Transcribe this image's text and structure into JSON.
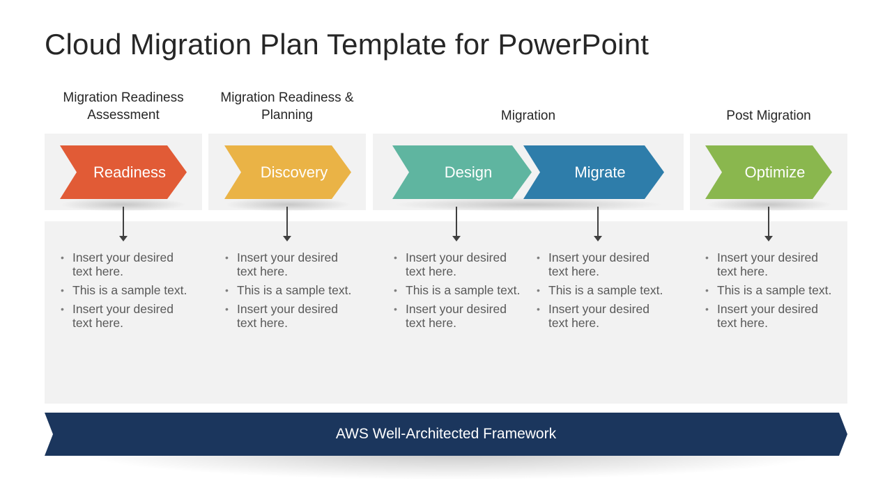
{
  "title": "Cloud Migration Plan Template for PowerPoint",
  "phases": [
    {
      "label_line1": "Migration Readiness",
      "label_line2": "Assessment"
    },
    {
      "label_line1": "Migration Readiness &",
      "label_line2": "Planning"
    },
    {
      "label_line1": "Migration",
      "label_line2": ""
    },
    {
      "label_line1": "Post Migration",
      "label_line2": ""
    }
  ],
  "steps": [
    {
      "label": "Readiness",
      "color": "#E15B36",
      "bullets": [
        "Insert your desired text here.",
        "This is a sample text.",
        "Insert your desired text here."
      ]
    },
    {
      "label": "Discovery",
      "color": "#EAB346",
      "bullets": [
        "Insert your desired text here.",
        "This is a sample text.",
        "Insert your desired text here."
      ]
    },
    {
      "label": "Design",
      "color": "#5FB5A0",
      "bullets": [
        "Insert your desired text here.",
        "This is a sample text.",
        "Insert your desired text here."
      ]
    },
    {
      "label": "Migrate",
      "color": "#2E7DAA",
      "bullets": [
        "Insert your desired text here.",
        "This is a sample text.",
        "Insert your desired text here."
      ]
    },
    {
      "label": "Optimize",
      "color": "#8AB74E",
      "bullets": [
        "Insert your desired text here.",
        "This is a sample text.",
        "Insert your desired text here."
      ]
    }
  ],
  "footer": {
    "label": "AWS Well-Architected Framework",
    "color": "#1B365D"
  }
}
